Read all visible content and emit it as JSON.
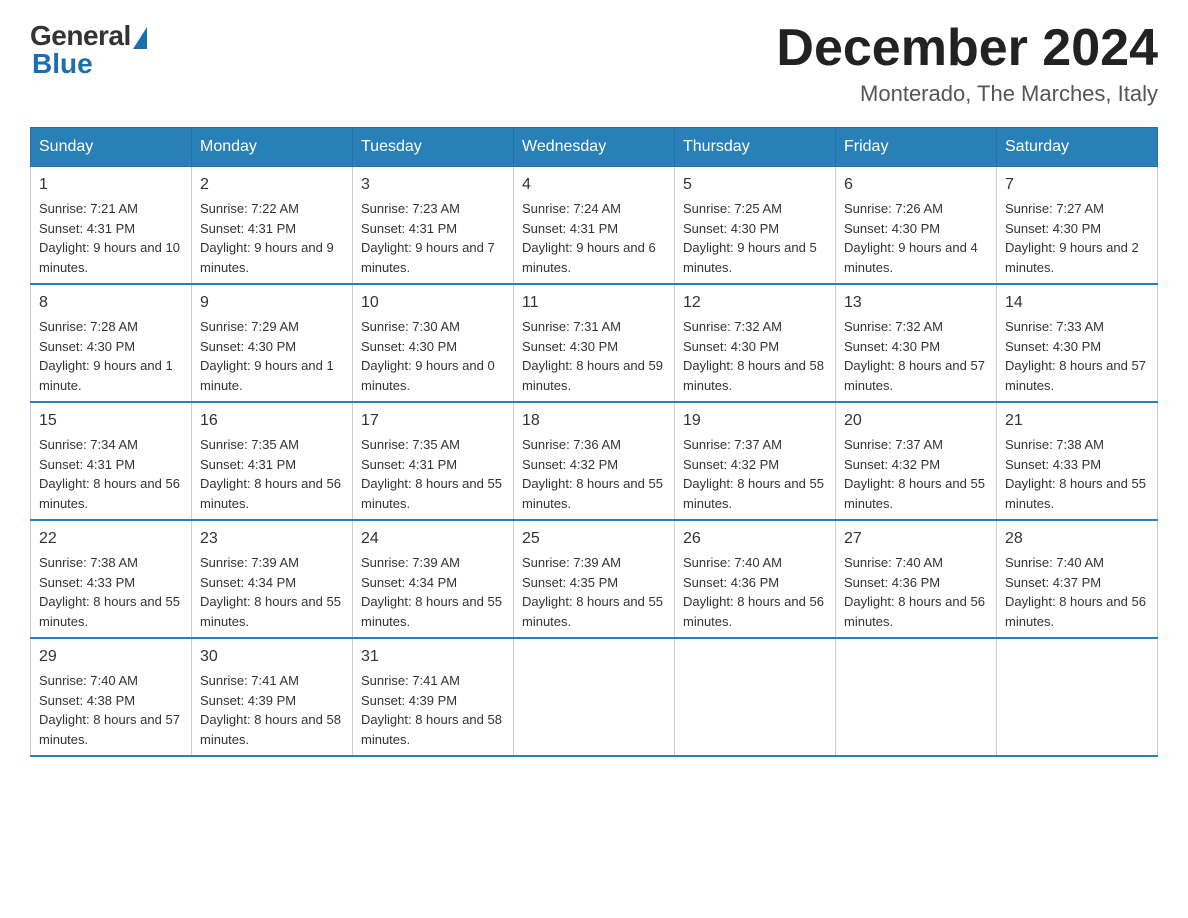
{
  "logo": {
    "general_text": "General",
    "blue_text": "Blue"
  },
  "header": {
    "title": "December 2024",
    "location": "Monterado, The Marches, Italy"
  },
  "days_of_week": [
    "Sunday",
    "Monday",
    "Tuesday",
    "Wednesday",
    "Thursday",
    "Friday",
    "Saturday"
  ],
  "weeks": [
    [
      {
        "day": "1",
        "sunrise": "7:21 AM",
        "sunset": "4:31 PM",
        "daylight": "9 hours and 10 minutes."
      },
      {
        "day": "2",
        "sunrise": "7:22 AM",
        "sunset": "4:31 PM",
        "daylight": "9 hours and 9 minutes."
      },
      {
        "day": "3",
        "sunrise": "7:23 AM",
        "sunset": "4:31 PM",
        "daylight": "9 hours and 7 minutes."
      },
      {
        "day": "4",
        "sunrise": "7:24 AM",
        "sunset": "4:31 PM",
        "daylight": "9 hours and 6 minutes."
      },
      {
        "day": "5",
        "sunrise": "7:25 AM",
        "sunset": "4:30 PM",
        "daylight": "9 hours and 5 minutes."
      },
      {
        "day": "6",
        "sunrise": "7:26 AM",
        "sunset": "4:30 PM",
        "daylight": "9 hours and 4 minutes."
      },
      {
        "day": "7",
        "sunrise": "7:27 AM",
        "sunset": "4:30 PM",
        "daylight": "9 hours and 2 minutes."
      }
    ],
    [
      {
        "day": "8",
        "sunrise": "7:28 AM",
        "sunset": "4:30 PM",
        "daylight": "9 hours and 1 minute."
      },
      {
        "day": "9",
        "sunrise": "7:29 AM",
        "sunset": "4:30 PM",
        "daylight": "9 hours and 1 minute."
      },
      {
        "day": "10",
        "sunrise": "7:30 AM",
        "sunset": "4:30 PM",
        "daylight": "9 hours and 0 minutes."
      },
      {
        "day": "11",
        "sunrise": "7:31 AM",
        "sunset": "4:30 PM",
        "daylight": "8 hours and 59 minutes."
      },
      {
        "day": "12",
        "sunrise": "7:32 AM",
        "sunset": "4:30 PM",
        "daylight": "8 hours and 58 minutes."
      },
      {
        "day": "13",
        "sunrise": "7:32 AM",
        "sunset": "4:30 PM",
        "daylight": "8 hours and 57 minutes."
      },
      {
        "day": "14",
        "sunrise": "7:33 AM",
        "sunset": "4:30 PM",
        "daylight": "8 hours and 57 minutes."
      }
    ],
    [
      {
        "day": "15",
        "sunrise": "7:34 AM",
        "sunset": "4:31 PM",
        "daylight": "8 hours and 56 minutes."
      },
      {
        "day": "16",
        "sunrise": "7:35 AM",
        "sunset": "4:31 PM",
        "daylight": "8 hours and 56 minutes."
      },
      {
        "day": "17",
        "sunrise": "7:35 AM",
        "sunset": "4:31 PM",
        "daylight": "8 hours and 55 minutes."
      },
      {
        "day": "18",
        "sunrise": "7:36 AM",
        "sunset": "4:32 PM",
        "daylight": "8 hours and 55 minutes."
      },
      {
        "day": "19",
        "sunrise": "7:37 AM",
        "sunset": "4:32 PM",
        "daylight": "8 hours and 55 minutes."
      },
      {
        "day": "20",
        "sunrise": "7:37 AM",
        "sunset": "4:32 PM",
        "daylight": "8 hours and 55 minutes."
      },
      {
        "day": "21",
        "sunrise": "7:38 AM",
        "sunset": "4:33 PM",
        "daylight": "8 hours and 55 minutes."
      }
    ],
    [
      {
        "day": "22",
        "sunrise": "7:38 AM",
        "sunset": "4:33 PM",
        "daylight": "8 hours and 55 minutes."
      },
      {
        "day": "23",
        "sunrise": "7:39 AM",
        "sunset": "4:34 PM",
        "daylight": "8 hours and 55 minutes."
      },
      {
        "day": "24",
        "sunrise": "7:39 AM",
        "sunset": "4:34 PM",
        "daylight": "8 hours and 55 minutes."
      },
      {
        "day": "25",
        "sunrise": "7:39 AM",
        "sunset": "4:35 PM",
        "daylight": "8 hours and 55 minutes."
      },
      {
        "day": "26",
        "sunrise": "7:40 AM",
        "sunset": "4:36 PM",
        "daylight": "8 hours and 56 minutes."
      },
      {
        "day": "27",
        "sunrise": "7:40 AM",
        "sunset": "4:36 PM",
        "daylight": "8 hours and 56 minutes."
      },
      {
        "day": "28",
        "sunrise": "7:40 AM",
        "sunset": "4:37 PM",
        "daylight": "8 hours and 56 minutes."
      }
    ],
    [
      {
        "day": "29",
        "sunrise": "7:40 AM",
        "sunset": "4:38 PM",
        "daylight": "8 hours and 57 minutes."
      },
      {
        "day": "30",
        "sunrise": "7:41 AM",
        "sunset": "4:39 PM",
        "daylight": "8 hours and 58 minutes."
      },
      {
        "day": "31",
        "sunrise": "7:41 AM",
        "sunset": "4:39 PM",
        "daylight": "8 hours and 58 minutes."
      },
      null,
      null,
      null,
      null
    ]
  ]
}
